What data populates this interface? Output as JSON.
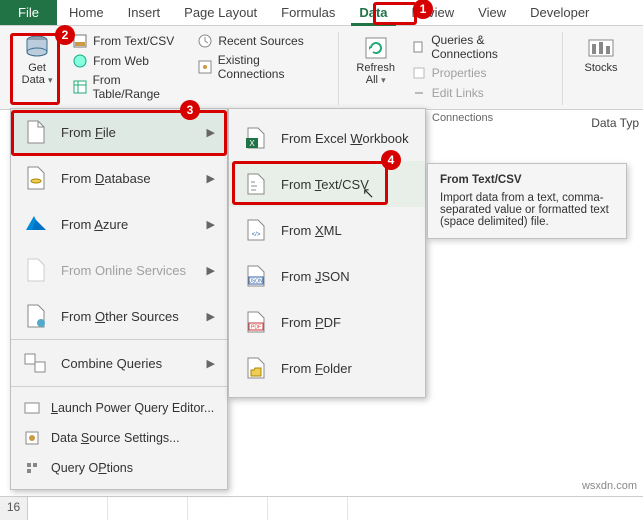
{
  "tabs": {
    "file": "File",
    "home": "Home",
    "insert": "Insert",
    "page_layout": "Page Layout",
    "formulas": "Formulas",
    "data": "Data",
    "review": "Review",
    "view": "View",
    "developer": "Developer"
  },
  "ribbon": {
    "get_data": "Get\nData",
    "from_text_csv": "From Text/CSV",
    "from_web": "From Web",
    "from_table_range": "From Table/Range",
    "recent_sources": "Recent Sources",
    "existing_connections": "Existing Connections",
    "refresh_all": "Refresh\nAll",
    "queries_connections": "Queries & Connections",
    "properties": "Properties",
    "edit_links": "Edit Links",
    "stocks": "Stocks",
    "data_types": "Data Typ",
    "connections_label": "Connections"
  },
  "menu1": {
    "from_file": "From File",
    "from_database": "From Database",
    "from_azure": "From Azure",
    "from_online_services": "From Online Services",
    "from_other_sources": "From Other Sources",
    "combine_queries": "Combine Queries",
    "launch_pq": "Launch Power Query Editor...",
    "data_source_settings": "Data Source Settings...",
    "query_options": "Query Options"
  },
  "menu1_accel": {
    "from_file": "F",
    "from_database": "D",
    "from_azure": "A",
    "from_other_sources": "O",
    "launch_pq": "L",
    "data_source_settings": "S",
    "query_options": "P"
  },
  "menu2": {
    "from_workbook": "From Excel Workbook",
    "from_text_csv": "From Text/CSV",
    "from_xml": "From XML",
    "from_json": "From JSON",
    "from_pdf": "From PDF",
    "from_folder": "From Folder"
  },
  "menu2_accel": {
    "from_workbook": "W",
    "from_text_csv": "T",
    "from_xml": "X",
    "from_json": "J",
    "from_pdf": "P",
    "from_folder": "F"
  },
  "tooltip": {
    "title": "From Text/CSV",
    "body": "Import data from a text, comma-separated value or formatted text (space delimited) file."
  },
  "badges": {
    "b1": "1",
    "b2": "2",
    "b3": "3",
    "b4": "4"
  },
  "row_number": "16",
  "watermark": "wsxdn.com"
}
